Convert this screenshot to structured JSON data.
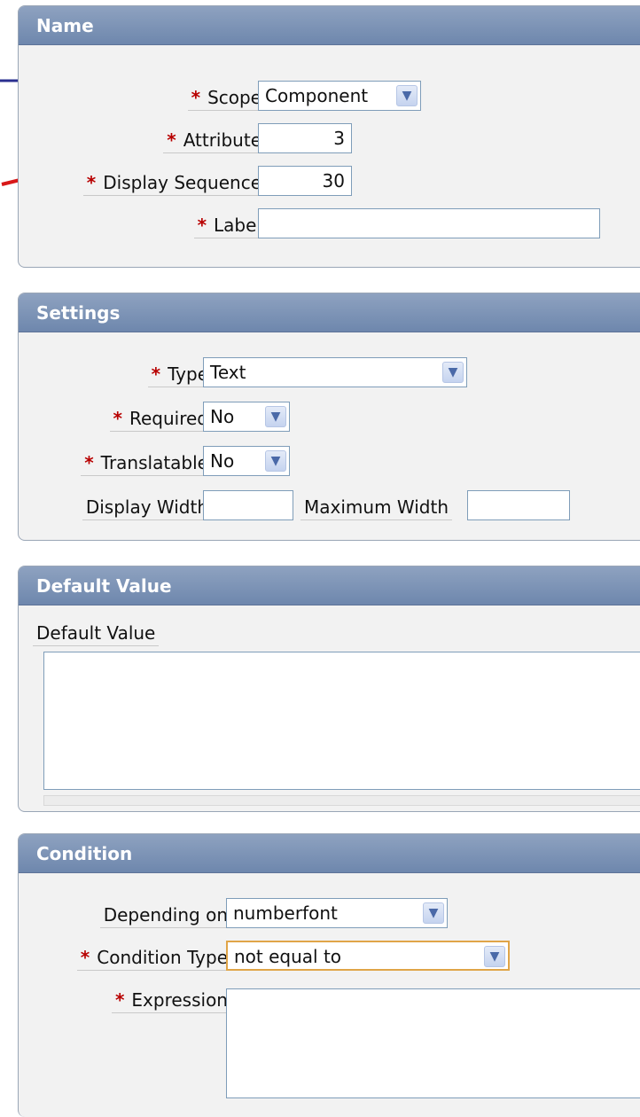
{
  "required_mark": "*",
  "dropdown_glyph": "▼",
  "name_section": {
    "title": "Name",
    "scope": {
      "label": "Scope",
      "value": "Component"
    },
    "attribute": {
      "label": "Attribute",
      "value": "3"
    },
    "display_sequence": {
      "label": "Display Sequence",
      "value": "30"
    },
    "label_field": {
      "label": "Label",
      "value": ""
    }
  },
  "settings_section": {
    "title": "Settings",
    "type": {
      "label": "Type",
      "value": "Text"
    },
    "required": {
      "label": "Required",
      "value": "No"
    },
    "translatable": {
      "label": "Translatable",
      "value": "No"
    },
    "display_width": {
      "label": "Display Width",
      "value": ""
    },
    "maximum_width": {
      "label": "Maximum Width",
      "value": ""
    }
  },
  "default_value_section": {
    "title": "Default Value",
    "default_value": {
      "label": "Default Value",
      "value": ""
    }
  },
  "condition_section": {
    "title": "Condition",
    "depending_on": {
      "label": "Depending on",
      "value": "numberfont"
    },
    "condition_type": {
      "label": "Condition Type",
      "value": "not equal to"
    },
    "expression": {
      "label": "Expression",
      "value": ""
    }
  },
  "colors": {
    "header_bg": "#7a91b5",
    "required_mark": "#b80000",
    "annotation_arrow": "#d81818",
    "focus_border": "#e0a548"
  }
}
